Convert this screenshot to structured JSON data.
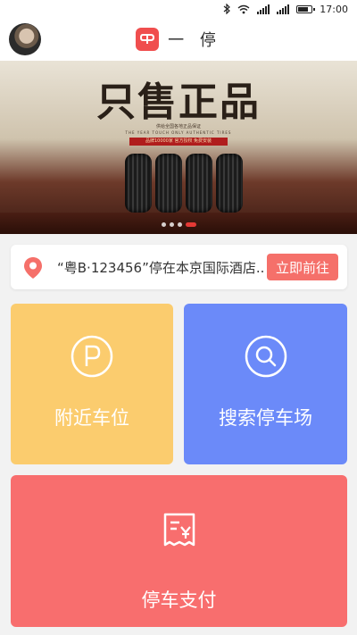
{
  "status_bar": {
    "time": "17:00",
    "icons": [
      "bluetooth-icon",
      "wifi-icon",
      "signal-icon",
      "signal-icon",
      "battery-icon"
    ]
  },
  "header": {
    "app_name": "一 停",
    "logo_icon": "parking-logo-icon",
    "avatar_icon": "user-avatar"
  },
  "banner": {
    "title": "只售正品",
    "subtitle_line1": "供给全国各地正品保证",
    "subtitle_line2": "THE YEAR TOUCH ONLY AUTHENTIC TIRES",
    "promo": "品牌10000家 官方授权 免费安装",
    "slide_count": 4,
    "active_slide": 4
  },
  "notice": {
    "text": "“粤B·123456”停在本京国际酒店..",
    "button_label": "立即前往",
    "icon": "location-pin-icon"
  },
  "tiles": {
    "nearby": {
      "label": "附近车位",
      "icon": "parking-p-icon"
    },
    "search": {
      "label": "搜索停车场",
      "icon": "search-icon"
    },
    "pay": {
      "label": "停车支付",
      "icon": "receipt-yen-icon"
    }
  },
  "colors": {
    "brand_red": "#f04e4e",
    "button_red": "#f5706a",
    "nearby_yellow": "#fbcc6e",
    "search_blue": "#6b8af9",
    "pay_red": "#f86e6e"
  }
}
